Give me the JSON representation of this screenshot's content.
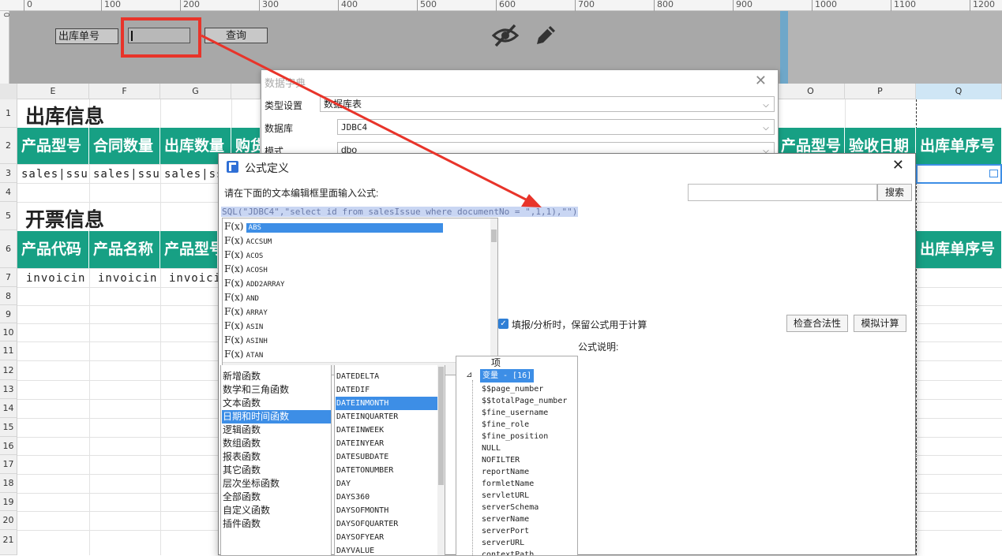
{
  "ruler": {
    "ticks": [
      "0",
      "100",
      "200",
      "300",
      "400",
      "500",
      "600",
      "700",
      "800",
      "900",
      "1000",
      "1100",
      "1200"
    ],
    "vertical_tick": "0"
  },
  "param_panel": {
    "label": "出库单号",
    "input_value": "",
    "query_button": "查询",
    "icons": [
      "eye-off-icon",
      "pencil-icon"
    ]
  },
  "sheet": {
    "columns": [
      "E",
      "F",
      "G",
      "O",
      "P",
      "Q"
    ],
    "rows": [
      "1",
      "2",
      "3",
      "4",
      "5",
      "6",
      "7",
      "8",
      "9",
      "10",
      "11",
      "12",
      "13",
      "14",
      "15",
      "16",
      "17",
      "18",
      "19",
      "20",
      "21"
    ],
    "section1_title": "出库信息",
    "section2_title": "开票信息",
    "headers_row2_left": [
      "产品型号",
      "合同数量",
      "出库数量",
      "购货"
    ],
    "headers_row2_right": [
      "产品型号",
      "验收日期",
      "出库单序号"
    ],
    "row3_values": [
      "sales|ssu",
      "sales|ssu",
      "sales|ssu"
    ],
    "headers_row6_left": [
      "产品代码",
      "产品名称",
      "产品型号"
    ],
    "headers_row6_right": [
      "出库单序号"
    ],
    "row7_values": [
      "invoicin",
      "invoicin",
      "invoici"
    ]
  },
  "data_dictionary": {
    "title": "数据字典",
    "type_label": "类型设置",
    "type_value": "数据库表",
    "db_label": "数据库",
    "db_value": "JDBC4",
    "schema_label": "模式",
    "schema_value": "dbo"
  },
  "formula_dialog": {
    "title": "公式定义",
    "instruction": "请在下面的文本编辑框里面输入公式:",
    "search_placeholder": "",
    "search_button": "搜索",
    "formula": "SQL(\"JDBC4\",\"select id from salesIssue where documentNo = \",1,1),\"\")",
    "autocomplete": [
      "ABS",
      "ACCSUM",
      "ACOS",
      "ACOSH",
      "ADD2ARRAY",
      "AND",
      "ARRAY",
      "ASIN",
      "ASINH",
      "ATAN"
    ],
    "fx_glyph": "F(x)",
    "keep_formula_label": "填报/分析时，保留公式用于计算",
    "keep_formula_checked": true,
    "check_button": "检查合法性",
    "simulate_button": "模拟计算",
    "desc_label": "公式说明:",
    "categories": [
      "新增函数",
      "数学和三角函数",
      "文本函数",
      "日期和时间函数",
      "逻辑函数",
      "数组函数",
      "报表函数",
      "其它函数",
      "层次坐标函数",
      "全部函数",
      "自定义函数",
      "插件函数"
    ],
    "selected_category": "日期和时间函数",
    "functions": [
      "DATEDELTA",
      "DATEDIF",
      "DATEINMONTH",
      "DATEINQUARTER",
      "DATEINWEEK",
      "DATEINYEAR",
      "DATESUBDATE",
      "DATETONUMBER",
      "DAY",
      "DAYS360",
      "DAYSOFMONTH",
      "DAYSOFQUARTER",
      "DAYSOFYEAR",
      "DAYVALUE"
    ],
    "selected_function": "DATEINMONTH",
    "tree_top": "项",
    "tree_group": "变量 - [16]",
    "variables": [
      "$$page_number",
      "$$totalPage_number",
      "$fine_username",
      "$fine_role",
      "$fine_position",
      "NULL",
      "NOFILTER",
      "reportName",
      "formletName",
      "servletURL",
      "serverSchema",
      "serverName",
      "serverPort",
      "serverURL",
      "contextPath"
    ]
  },
  "colors": {
    "teal": "#17a084",
    "selection": "#3d8ee6",
    "annotation_red": "#e8342a"
  }
}
